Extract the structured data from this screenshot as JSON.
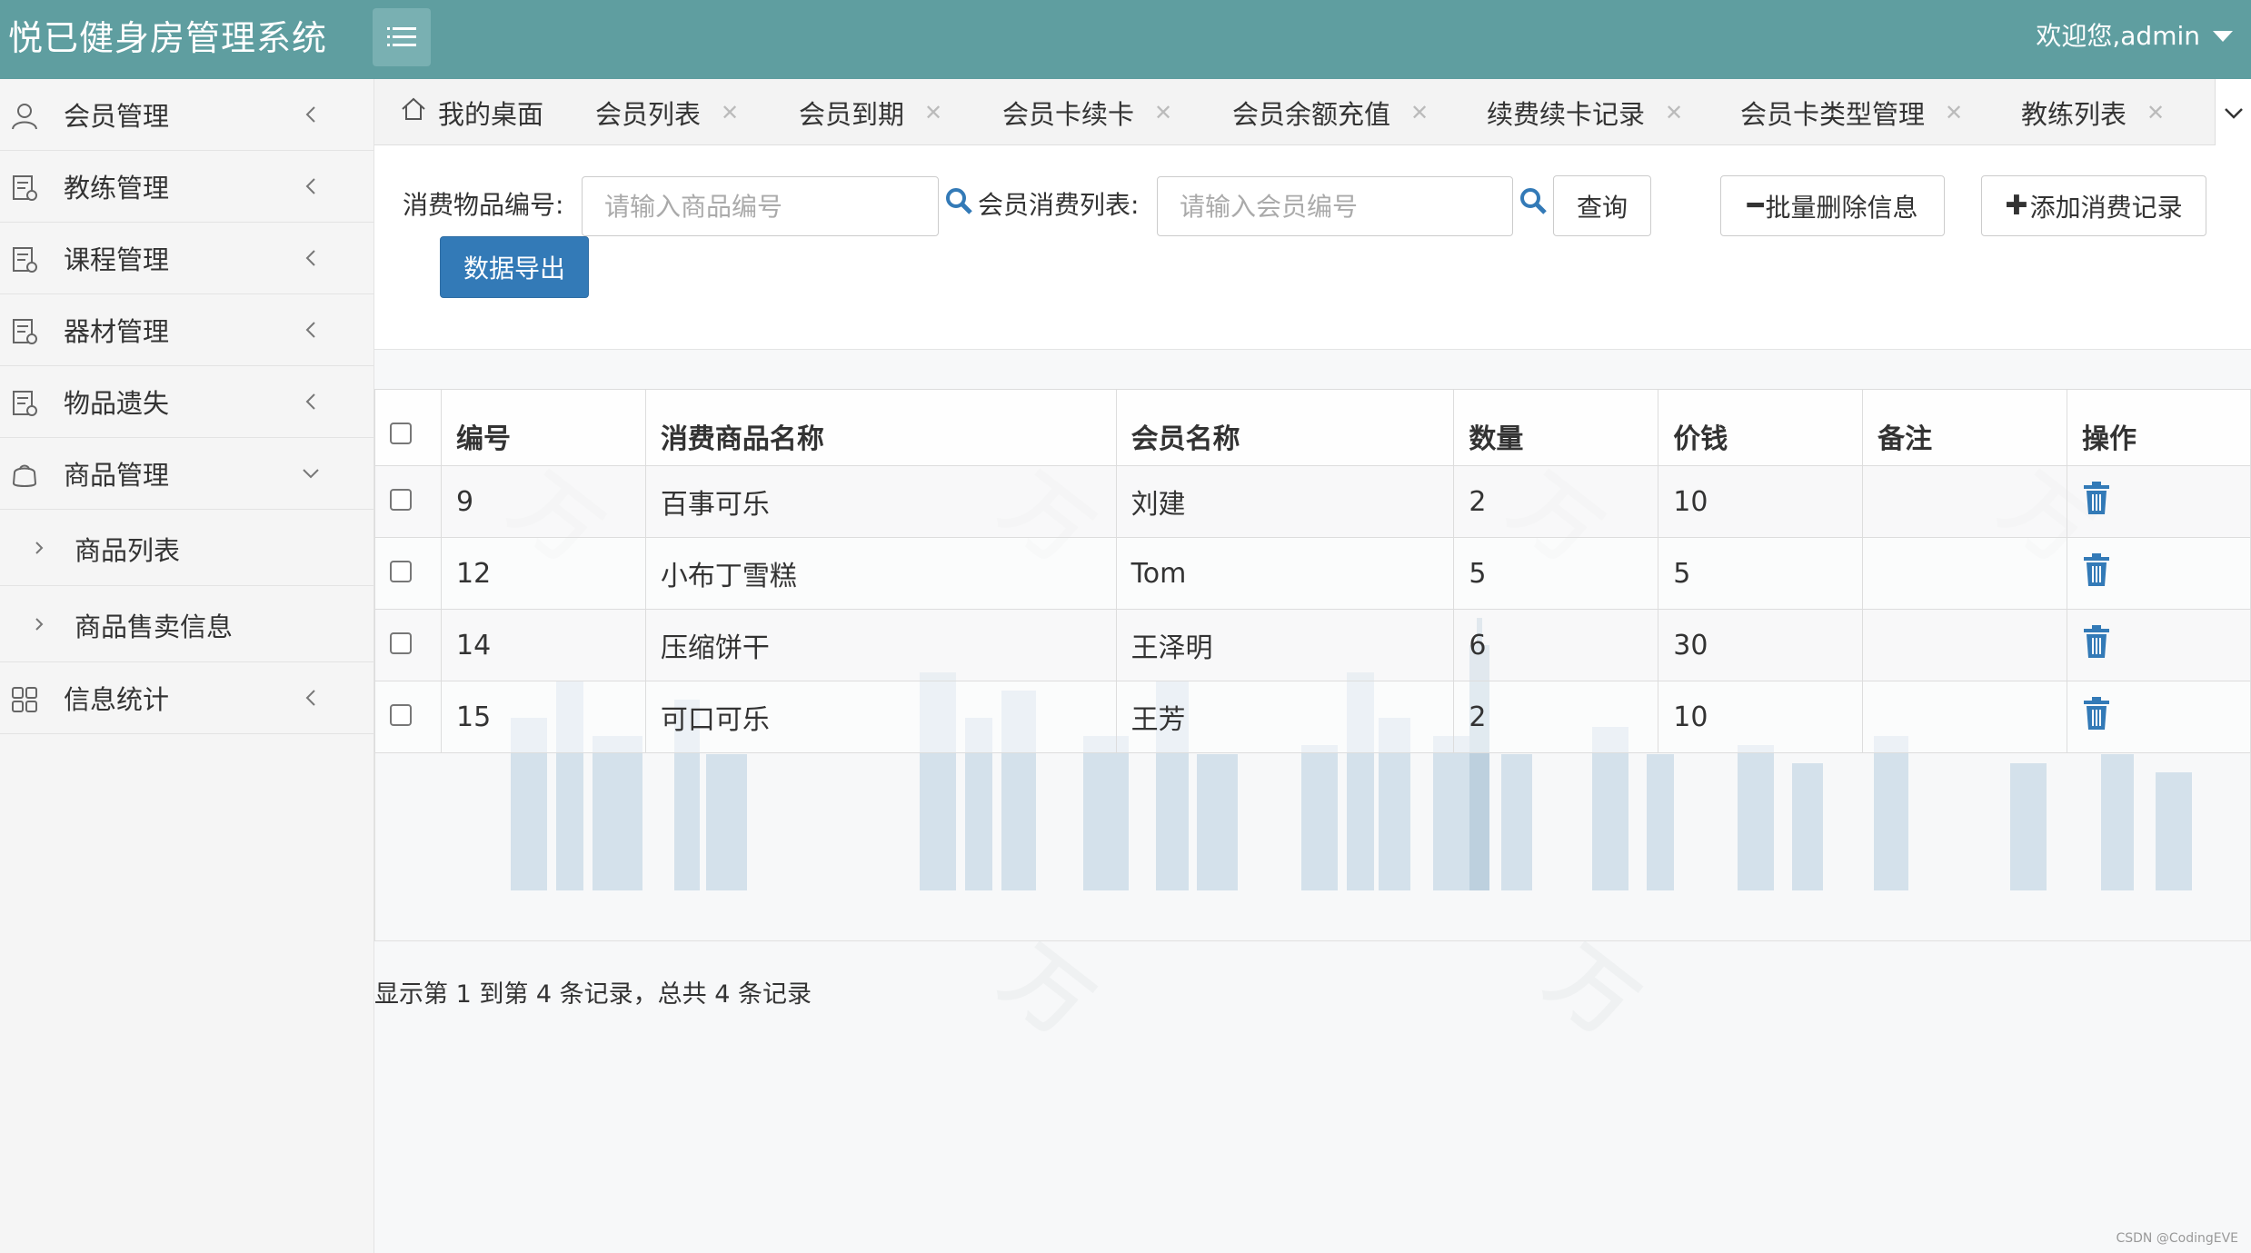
{
  "header": {
    "title": "悦已健身房管理系统",
    "welcome": "欢迎您,admin"
  },
  "sidebar": {
    "items": [
      {
        "label": "会员管理",
        "icon": "user-icon"
      },
      {
        "label": "教练管理",
        "icon": "document-icon"
      },
      {
        "label": "课程管理",
        "icon": "document-icon"
      },
      {
        "label": "器材管理",
        "icon": "document-icon"
      },
      {
        "label": "物品遗失",
        "icon": "document-icon"
      },
      {
        "label": "商品管理",
        "icon": "shopping-bag-icon",
        "expanded": true
      },
      {
        "label": "信息统计",
        "icon": "grid-icon"
      }
    ],
    "subitems": [
      {
        "label": "商品列表"
      },
      {
        "label": "商品售卖信息"
      }
    ]
  },
  "tabs": [
    {
      "label": "我的桌面"
    },
    {
      "label": "会员列表"
    },
    {
      "label": "会员到期"
    },
    {
      "label": "会员卡续卡"
    },
    {
      "label": "会员余额充值"
    },
    {
      "label": "续费续卡记录"
    },
    {
      "label": "会员卡类型管理"
    },
    {
      "label": "教练列表"
    }
  ],
  "toolbar": {
    "item_no_label": "消费物品编号:",
    "item_no_placeholder": "请输入商品编号",
    "member_label": "会员消费列表:",
    "member_placeholder": "请输入会员编号",
    "query_label": "查询",
    "batch_delete_label": "批量删除信息",
    "add_label": "添加消费记录",
    "export_label": "数据导出"
  },
  "table": {
    "headers": [
      "编号",
      "消费商品名称",
      "会员名称",
      "数量",
      "价钱",
      "备注",
      "操作"
    ],
    "rows": [
      {
        "id": "9",
        "product": "百事可乐",
        "member": "刘建",
        "qty": "2",
        "price": "10",
        "note": ""
      },
      {
        "id": "12",
        "product": "小布丁雪糕",
        "member": "Tom",
        "qty": "5",
        "price": "5",
        "note": ""
      },
      {
        "id": "14",
        "product": "压缩饼干",
        "member": "王泽明",
        "qty": "6",
        "price": "30",
        "note": ""
      },
      {
        "id": "15",
        "product": "可口可乐",
        "member": "王芳",
        "qty": "2",
        "price": "10",
        "note": ""
      }
    ]
  },
  "pager": {
    "summary": "显示第 1 到第 4 条记录，总共 4 条记录"
  },
  "footer": {
    "credit": "CSDN @CodingEVE"
  },
  "colors": {
    "header_bg": "#5f9ea0",
    "primary_button": "#337ab7",
    "trash_icon": "#337ab7"
  }
}
